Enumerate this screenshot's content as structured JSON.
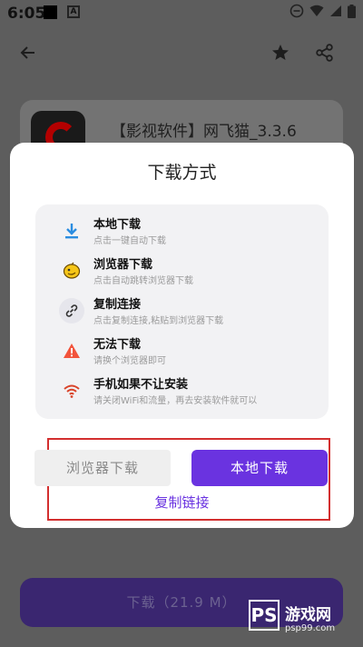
{
  "status_bar": {
    "time": "6:05",
    "notif_icon_text": "A"
  },
  "app_bar": {
    "back_icon": "arrow-left-icon",
    "star_icon": "star-icon",
    "share_icon": "share-icon"
  },
  "app_card": {
    "title": "【影视软件】网飞猫_3.3.6"
  },
  "bottom_button": {
    "label": "下载（21.9 M）"
  },
  "dialog": {
    "title": "下载方式",
    "options": [
      {
        "icon": "download-icon",
        "title": "本地下载",
        "subtitle": "点击一键自动下载"
      },
      {
        "icon": "browser-icon",
        "title": "浏览器下载",
        "subtitle": "点击自动跳转浏览器下载"
      },
      {
        "icon": "link-icon",
        "title": "复制连接",
        "subtitle": "点击复制连接,粘贴到浏览器下载"
      },
      {
        "icon": "warning-icon",
        "title": "无法下载",
        "subtitle": "请换个浏览器即可"
      },
      {
        "icon": "wifi-icon",
        "title": "手机如果不让安装",
        "subtitle": "请关闭WiFi和流量，再去安装软件就可以"
      }
    ],
    "browser_button": "浏览器下载",
    "local_button": "本地下载",
    "copy_link": "复制链接"
  },
  "watermark": {
    "logo": "PS",
    "brand": "游戏网",
    "url": "psp99.com"
  },
  "colors": {
    "accent": "#6a33e0",
    "highlight": "#d32f2f"
  }
}
